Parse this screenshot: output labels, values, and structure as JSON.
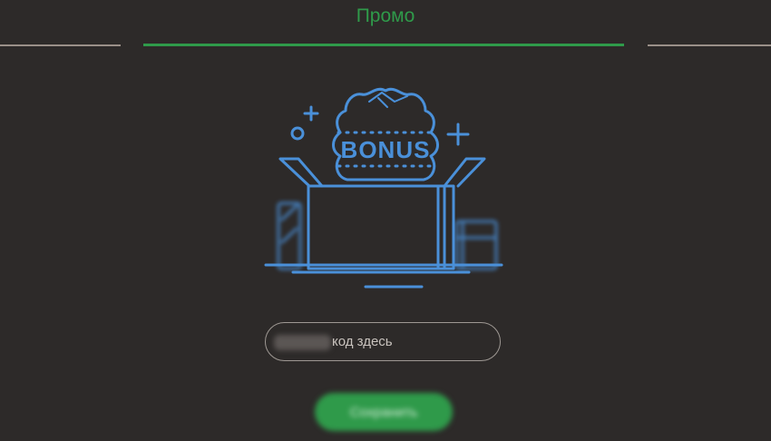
{
  "header": {
    "title": "Промо"
  },
  "tabs": [
    {
      "label": "",
      "active": false
    },
    {
      "label": "",
      "active": true
    },
    {
      "label": "",
      "active": false
    }
  ],
  "illustration": {
    "icon": "bonus-box-icon",
    "badge_text": "BONUS"
  },
  "promo": {
    "placeholder_visible": "код здесь"
  },
  "save_button": {
    "label": "Сохранить"
  },
  "colors": {
    "background": "#2d2a29",
    "accent_green": "#2f9a4a",
    "illustration_blue": "#4a90d9",
    "tab_inactive": "#9a8f88"
  }
}
